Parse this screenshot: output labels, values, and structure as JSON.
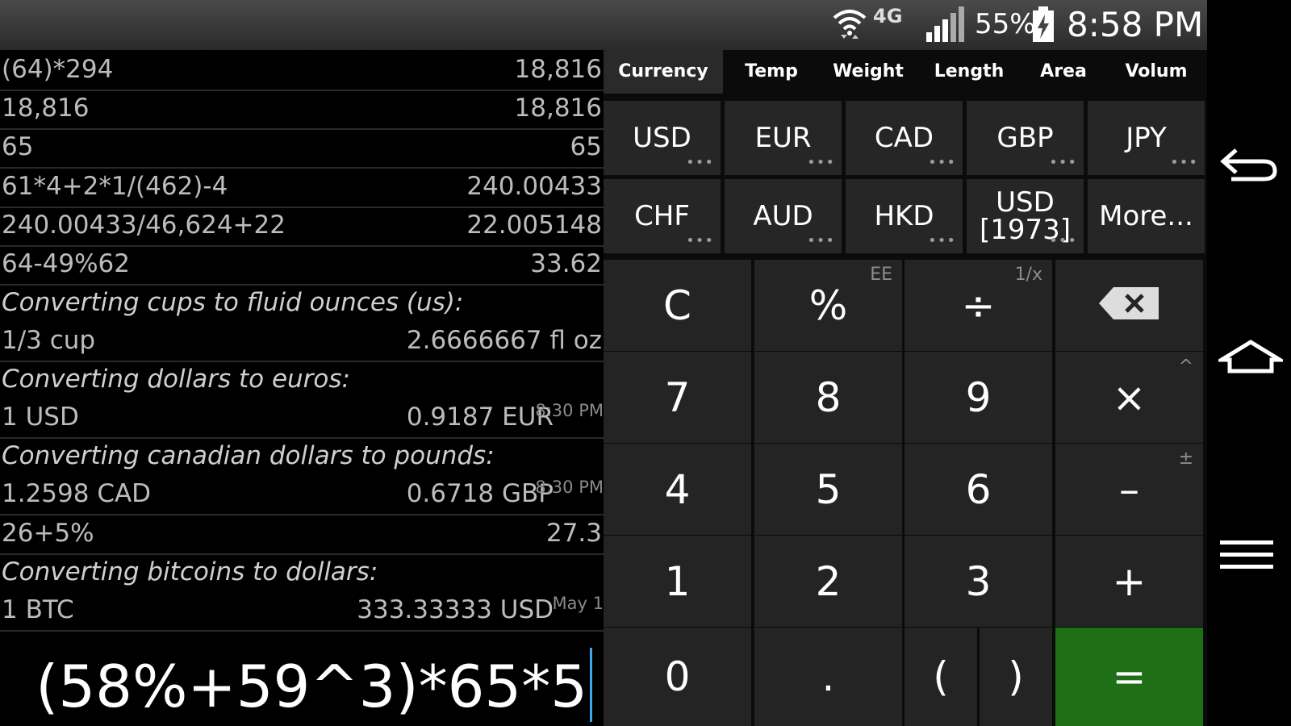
{
  "status_bar": {
    "network": "4G",
    "battery_percent": "55%",
    "time": "8:58 PM"
  },
  "history": [
    {
      "expr": "(64)*294",
      "result": "18,816"
    },
    {
      "expr": "18,816",
      "result": "18,816"
    },
    {
      "expr": "65",
      "result": "65"
    },
    {
      "expr": "61*4+2*1/(462)-4",
      "result": "240.00433"
    },
    {
      "expr": "240.00433/46,624+22",
      "result": "22.005148"
    },
    {
      "expr": "64-49%62",
      "result": "33.62"
    },
    {
      "note": "Converting cups to fluid ounces (us):"
    },
    {
      "expr": "1/3 cup",
      "result": "2.6666667 fl oz"
    },
    {
      "note": "Converting dollars to euros:"
    },
    {
      "expr": "1 USD",
      "result": "0.9187 EUR",
      "timestamp": "8:30 PM"
    },
    {
      "note": "Converting canadian dollars to pounds:"
    },
    {
      "expr": "1.2598 CAD",
      "result": "0.6718 GBP",
      "timestamp": "8:30 PM"
    },
    {
      "expr": "26+5%",
      "result": "27.3"
    },
    {
      "note": "Converting bitcoins to dollars:"
    },
    {
      "expr": "1 BTC",
      "result": "333.33333 USD",
      "timestamp": "May 1"
    }
  ],
  "input": {
    "value": "(58%+59^3)*65*5"
  },
  "tabs": [
    "Currency",
    "Temp",
    "Weight",
    "Length",
    "Area",
    "Volum"
  ],
  "currency_buttons": [
    {
      "label": "USD"
    },
    {
      "label": "EUR"
    },
    {
      "label": "CAD"
    },
    {
      "label": "GBP"
    },
    {
      "label": "JPY"
    },
    {
      "label": "CHF"
    },
    {
      "label": "AUD"
    },
    {
      "label": "HKD"
    },
    {
      "label": "USD\n[1973]"
    },
    {
      "label": "More..."
    }
  ],
  "keypad": {
    "clear": "C",
    "percent": "%",
    "percent_alt": "EE",
    "divide": "÷",
    "divide_alt": "1/x",
    "seven": "7",
    "eight": "8",
    "nine": "9",
    "multiply": "×",
    "multiply_alt": "^",
    "four": "4",
    "five": "5",
    "six": "6",
    "minus": "–",
    "minus_alt": "±",
    "one": "1",
    "two": "2",
    "three": "3",
    "plus": "+",
    "zero": "0",
    "dot": ".",
    "lparen": "(",
    "rparen": ")",
    "equals": "="
  },
  "colors": {
    "accent_cursor": "#3ea7e8",
    "equals_key": "#1f6f17"
  },
  "icons": {
    "back": "back-arrow-icon",
    "home": "home-icon",
    "menu": "menu-icon",
    "backspace": "backspace-icon"
  }
}
